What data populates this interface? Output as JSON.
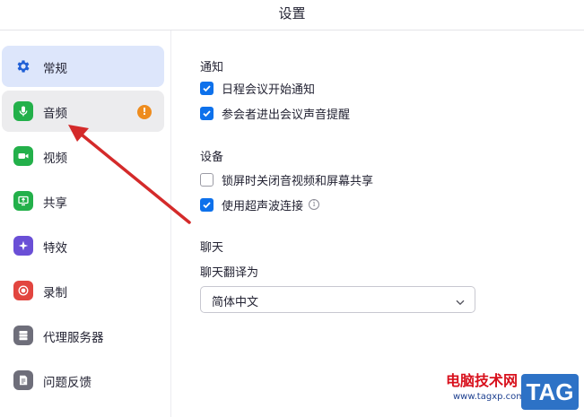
{
  "window": {
    "title": "设置"
  },
  "sidebar": {
    "items": [
      {
        "label": "常规",
        "icon": "gear-icon",
        "color": "#1f5fd6",
        "state": "selected"
      },
      {
        "label": "音频",
        "icon": "microphone-icon",
        "color": "#23b04a",
        "state": "hover",
        "badge": "!"
      },
      {
        "label": "视频",
        "icon": "video-camera-icon",
        "color": "#23b04a"
      },
      {
        "label": "共享",
        "icon": "share-screen-icon",
        "color": "#23b04a"
      },
      {
        "label": "特效",
        "icon": "effects-icon",
        "color": "#6a4fd6"
      },
      {
        "label": "录制",
        "icon": "record-icon",
        "color": "#e2453f"
      },
      {
        "label": "代理服务器",
        "icon": "proxy-server-icon",
        "color": "#6e6e7a"
      },
      {
        "label": "问题反馈",
        "icon": "feedback-icon",
        "color": "#6e6e7a"
      }
    ]
  },
  "main": {
    "notifications": {
      "heading": "通知",
      "options": [
        {
          "label": "日程会议开始通知",
          "checked": true
        },
        {
          "label": "参会者进出会议声音提醒",
          "checked": true
        }
      ]
    },
    "device": {
      "heading": "设备",
      "options": [
        {
          "label": "锁屏时关闭音视频和屏幕共享",
          "checked": false
        },
        {
          "label": "使用超声波连接",
          "checked": true,
          "info": "i"
        }
      ]
    },
    "chat": {
      "heading": "聊天",
      "translate_label": "聊天翻译为",
      "translate_value": "简体中文"
    }
  },
  "watermark": {
    "brand": "电脑技术网",
    "url": "www.tagxp.com",
    "tag": "TAG"
  },
  "colors": {
    "accent": "#0e71eb",
    "selected_bg": "#dde6fb",
    "badge": "#ee8c1e",
    "annotation_arrow": "#d42a2a"
  }
}
